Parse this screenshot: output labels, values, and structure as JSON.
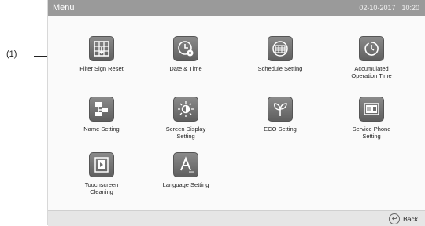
{
  "callout": "(1)",
  "header": {
    "title": "Menu",
    "date": "02-10-2017",
    "time": "10:20"
  },
  "menu": [
    {
      "label": "Filter Sign Reset",
      "icon": "filter-grid-icon"
    },
    {
      "label": "Date & Time",
      "icon": "clock-gear-icon"
    },
    {
      "label": "Schedule Setting",
      "icon": "calendar-icon"
    },
    {
      "label": "Accumulated\nOperation Time",
      "icon": "timer-icon"
    },
    {
      "label": "Name Setting",
      "icon": "hierarchy-icon"
    },
    {
      "label": "Screen Display\nSetting",
      "icon": "sun-icon"
    },
    {
      "label": "ECO Setting",
      "icon": "leaf-icon"
    },
    {
      "label": "Service Phone\nSetting",
      "icon": "contact-card-icon"
    },
    {
      "label": "Touchscreen\nCleaning",
      "icon": "touchscreen-icon"
    },
    {
      "label": "Language Setting",
      "icon": "letter-a-icon"
    }
  ],
  "footer": {
    "back_label": "Back"
  },
  "colors": {
    "titlebar": "#9a9a9a",
    "icon_bg": "#6f6f6f",
    "footer": "#e6e6e6"
  }
}
